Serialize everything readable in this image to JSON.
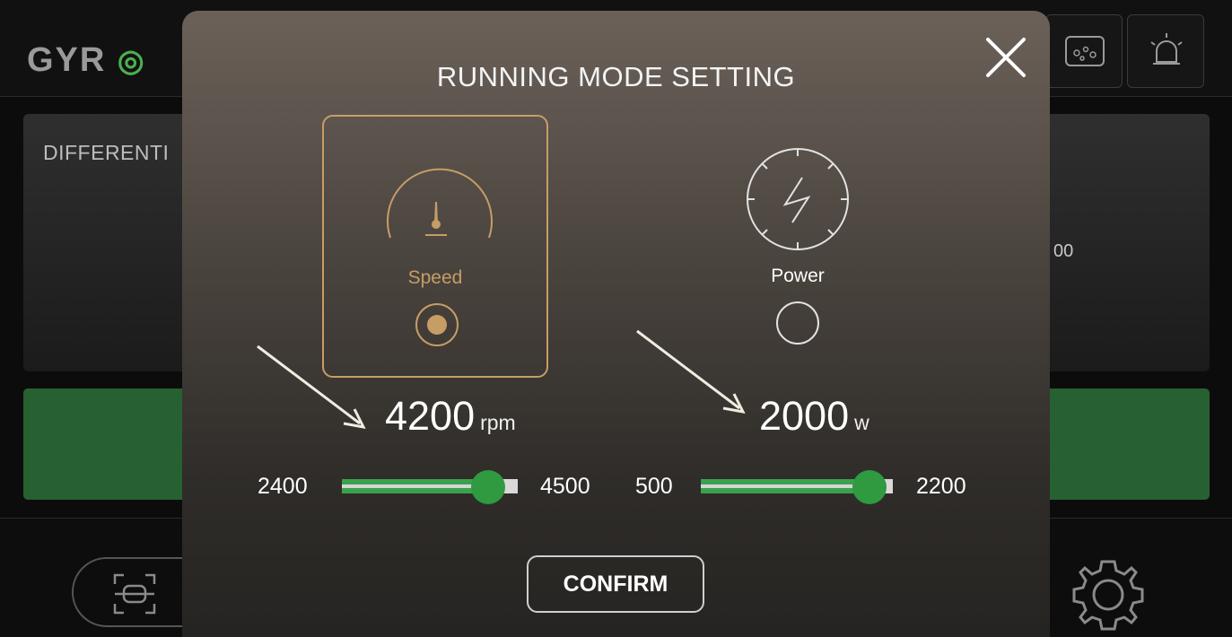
{
  "app": {
    "logo_text": "GYR",
    "logo_swirl": "◎",
    "diff_label": "DIFFERENTI",
    "diff_value": "00"
  },
  "modal": {
    "title": "RUNNING MODE SETTING",
    "modes": {
      "speed": {
        "label": "Speed",
        "selected": true,
        "icon": "speedometer-icon"
      },
      "power": {
        "label": "Power",
        "selected": false,
        "icon": "power-bolt-icon"
      }
    },
    "speed_setting": {
      "value": "4200",
      "unit": "rpm",
      "min": "2400",
      "max": "4500",
      "fraction": 0.83
    },
    "power_setting": {
      "value": "2000",
      "unit": "w",
      "min": "500",
      "max": "2200",
      "fraction": 0.88
    },
    "confirm_label": "CONFIRM"
  },
  "colors": {
    "accent_gold": "#c79d66",
    "slider_green": "#3aa24c",
    "knob_green": "#2f9a3f"
  }
}
